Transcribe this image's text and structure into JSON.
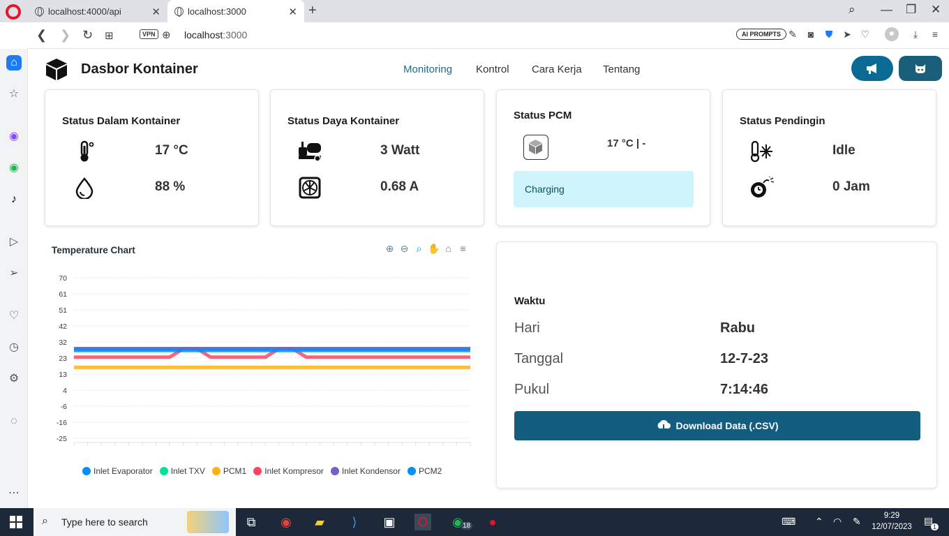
{
  "browser": {
    "tabs": [
      {
        "title": "localhost:4000/api"
      },
      {
        "title": "localhost:3000"
      }
    ],
    "url_host": "localhost",
    "url_port": ":3000",
    "vpn_label": "VPN",
    "ai_prompts_label": "AI PROMPTS"
  },
  "header": {
    "brand": "Dasbor Kontainer",
    "menu": [
      "Monitoring",
      "Kontrol",
      "Cara Kerja",
      "Tentang"
    ]
  },
  "cards": {
    "dalam": {
      "title": "Status Dalam Kontainer",
      "temp": "17 °C",
      "humidity": "88 %"
    },
    "daya": {
      "title": "Status Daya Kontainer",
      "power": "3 Watt",
      "current": "0.68 A"
    },
    "pcm": {
      "title": "Status PCM",
      "value": "17 °C | -",
      "status": "Charging"
    },
    "pendingin": {
      "title": "Status Pendingin",
      "state": "Idle",
      "duration": "0 Jam"
    }
  },
  "chart_data": {
    "type": "line",
    "title": "Temperature Chart",
    "y_ticks": [
      "70",
      "61",
      "51",
      "42",
      "32",
      "23",
      "13",
      "4",
      "-6",
      "-16",
      "-25"
    ],
    "ylim": [
      -25,
      70
    ],
    "x": [
      0,
      1,
      2,
      3,
      4,
      5,
      6,
      7,
      8,
      9,
      10,
      11,
      12,
      13,
      14,
      15,
      16,
      17,
      18,
      19,
      20,
      21,
      22,
      23,
      24,
      25,
      26,
      27,
      28,
      29
    ],
    "series": [
      {
        "name": "Inlet Evaporator",
        "color": "#008ffb",
        "values": [
          28,
          28,
          28,
          28,
          28,
          28,
          28,
          28,
          28,
          28,
          28,
          28,
          28,
          28,
          28,
          28,
          28,
          28,
          28,
          28,
          28,
          28,
          28,
          28,
          28,
          28,
          28,
          28,
          28,
          28
        ]
      },
      {
        "name": "Inlet TXV",
        "color": "#00e396",
        "values": [
          28,
          28,
          28,
          28,
          28,
          28,
          28,
          28,
          28,
          28,
          28,
          28,
          28,
          28,
          28,
          28,
          28,
          28,
          28,
          28,
          28,
          28,
          28,
          28,
          28,
          28,
          28,
          28,
          28,
          28
        ]
      },
      {
        "name": "PCM1",
        "color": "#feb019",
        "values": [
          17,
          17,
          17,
          17,
          17,
          17,
          17,
          17,
          17,
          17,
          17,
          17,
          17,
          17,
          17,
          17,
          17,
          17,
          17,
          17,
          17,
          17,
          17,
          17,
          17,
          17,
          17,
          17,
          17,
          17
        ]
      },
      {
        "name": "Inlet Kompresor",
        "color": "#ff4560",
        "values": [
          23,
          23,
          23,
          23,
          23,
          23,
          23,
          23,
          28,
          28,
          23,
          23,
          23,
          23,
          23,
          28,
          28,
          23,
          23,
          23,
          23,
          23,
          23,
          23,
          23,
          23,
          23,
          23,
          23,
          23
        ]
      },
      {
        "name": "Inlet Kondensor",
        "color": "#775dd0",
        "values": [
          28,
          28,
          28,
          28,
          28,
          28,
          28,
          28,
          28,
          28,
          28,
          28,
          28,
          28,
          28,
          28,
          28,
          28,
          28,
          28,
          28,
          28,
          28,
          28,
          28,
          28,
          28,
          28,
          28,
          28
        ]
      },
      {
        "name": "PCM2",
        "color": "#008ffb",
        "values": [
          27,
          27,
          27,
          27,
          27,
          27,
          27,
          27,
          27,
          27,
          27,
          27,
          27,
          27,
          27,
          27,
          27,
          27,
          27,
          27,
          27,
          27,
          27,
          27,
          27,
          27,
          27,
          27,
          27,
          27
        ]
      }
    ]
  },
  "waktu": {
    "title": "Waktu",
    "rows": [
      {
        "label": "Hari",
        "value": "Rabu"
      },
      {
        "label": "Tanggal",
        "value": "12-7-23"
      },
      {
        "label": "Pukul",
        "value": "7:14:46"
      }
    ],
    "download_label": "Download Data (.CSV)"
  },
  "taskbar": {
    "search_placeholder": "Type here to search",
    "whatsapp_badge": "18",
    "time": "9:29",
    "date": "12/07/2023",
    "notif_count": "1"
  }
}
